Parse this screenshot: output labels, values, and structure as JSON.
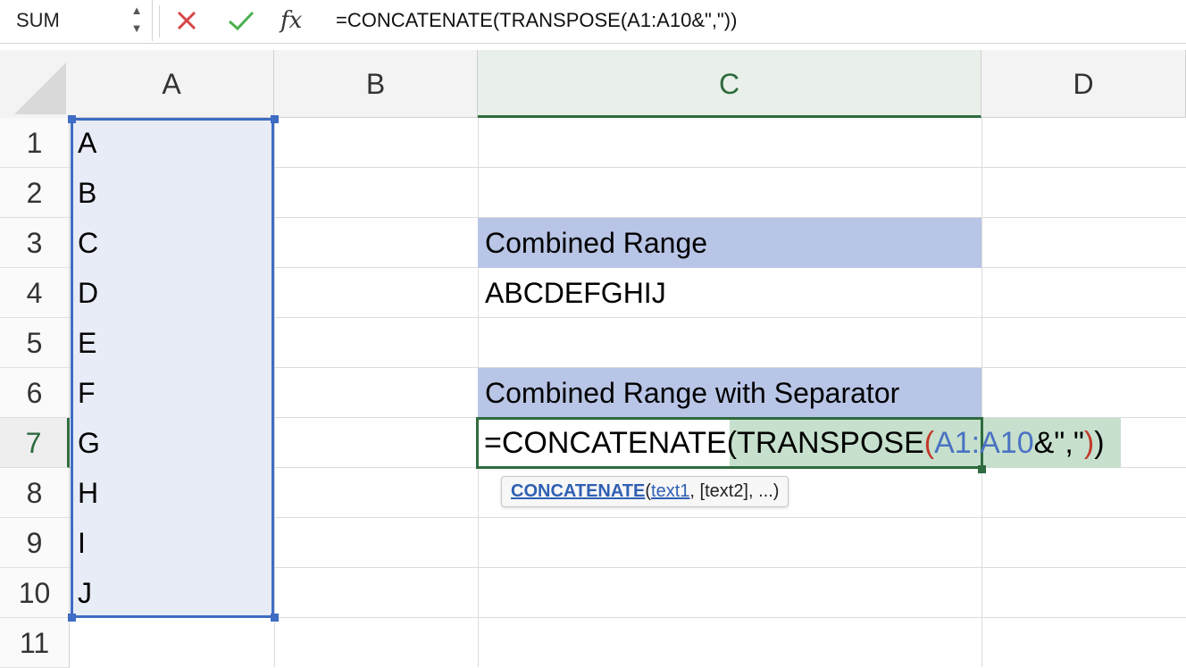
{
  "formula_bar": {
    "name_box": "SUM",
    "name_box_icon": "stepper-arrows-icon",
    "cancel_icon": "x-icon",
    "confirm_icon": "checkmark-icon",
    "function_label": "fx",
    "formula": "=CONCATENATE(TRANSPOSE(A1:A10&\",\"))"
  },
  "columns": [
    "A",
    "B",
    "C",
    "D"
  ],
  "active_column": "C",
  "rows": [
    "1",
    "2",
    "3",
    "4",
    "5",
    "6",
    "7",
    "8",
    "9",
    "10",
    "11"
  ],
  "active_row": "7",
  "column_a": [
    "A",
    "B",
    "C",
    "D",
    "E",
    "F",
    "G",
    "H",
    "I",
    "J"
  ],
  "cells": {
    "c3": "Combined Range",
    "c4": "ABCDEFGHIJ",
    "c6": "Combined Range with Separator"
  },
  "edit": {
    "t1": "=CONCATENATE",
    "t2": "(",
    "t3": "TRANSPOSE",
    "t4": "(",
    "t5": "A1:A10",
    "t6": "&\",\"",
    "t7": ")",
    "t8": ")"
  },
  "tooltip": {
    "function": "CONCATENATE",
    "open": "(",
    "arg1": "text1",
    "rest": ", [text2], ...)"
  },
  "colors": {
    "selection_border": "#3f6cc4",
    "selection_fill": "#e8ecf7",
    "header_fill": "#b8c5e6",
    "active_green": "#2e6b3e",
    "formula_highlight": "#c6e0cd",
    "paren_red": "#c0392b",
    "ref_blue": "#4a72c2"
  }
}
